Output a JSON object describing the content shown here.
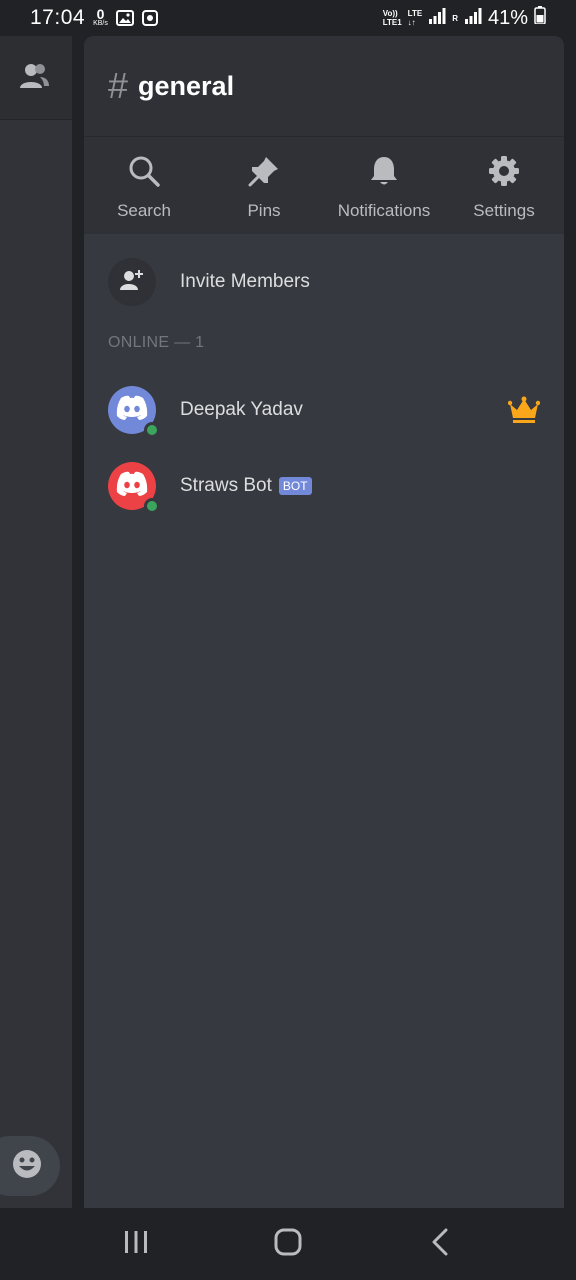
{
  "status_bar": {
    "time": "17:04",
    "data_speed_value": "0",
    "data_speed_unit": "KB/s",
    "network_top": "Vo))",
    "network_bottom": "LTE1",
    "lte_top": "LTE",
    "lte_bottom": "↓↑",
    "roaming": "R",
    "battery_percent": "41%"
  },
  "channel": {
    "hash_symbol": "#",
    "name": "general"
  },
  "actions": [
    {
      "label": "Search",
      "icon": "search-icon"
    },
    {
      "label": "Pins",
      "icon": "pin-icon"
    },
    {
      "label": "Notifications",
      "icon": "bell-icon"
    },
    {
      "label": "Settings",
      "icon": "gear-icon"
    }
  ],
  "invite": {
    "label": "Invite Members",
    "icon": "add-person-icon"
  },
  "sections": [
    {
      "header": "ONLINE — 1",
      "members": [
        {
          "name": "Deepak Yadav",
          "avatar_color": "#7289da",
          "status": "online",
          "owner": true
        },
        {
          "name": "Straws Bot",
          "avatar_color": "#ed4245",
          "status": "online",
          "bot_tag": "BOT"
        }
      ]
    }
  ],
  "colors": {
    "online": "#3ba55d",
    "crown": "#faa61a",
    "bot_tag": "#7289da"
  }
}
